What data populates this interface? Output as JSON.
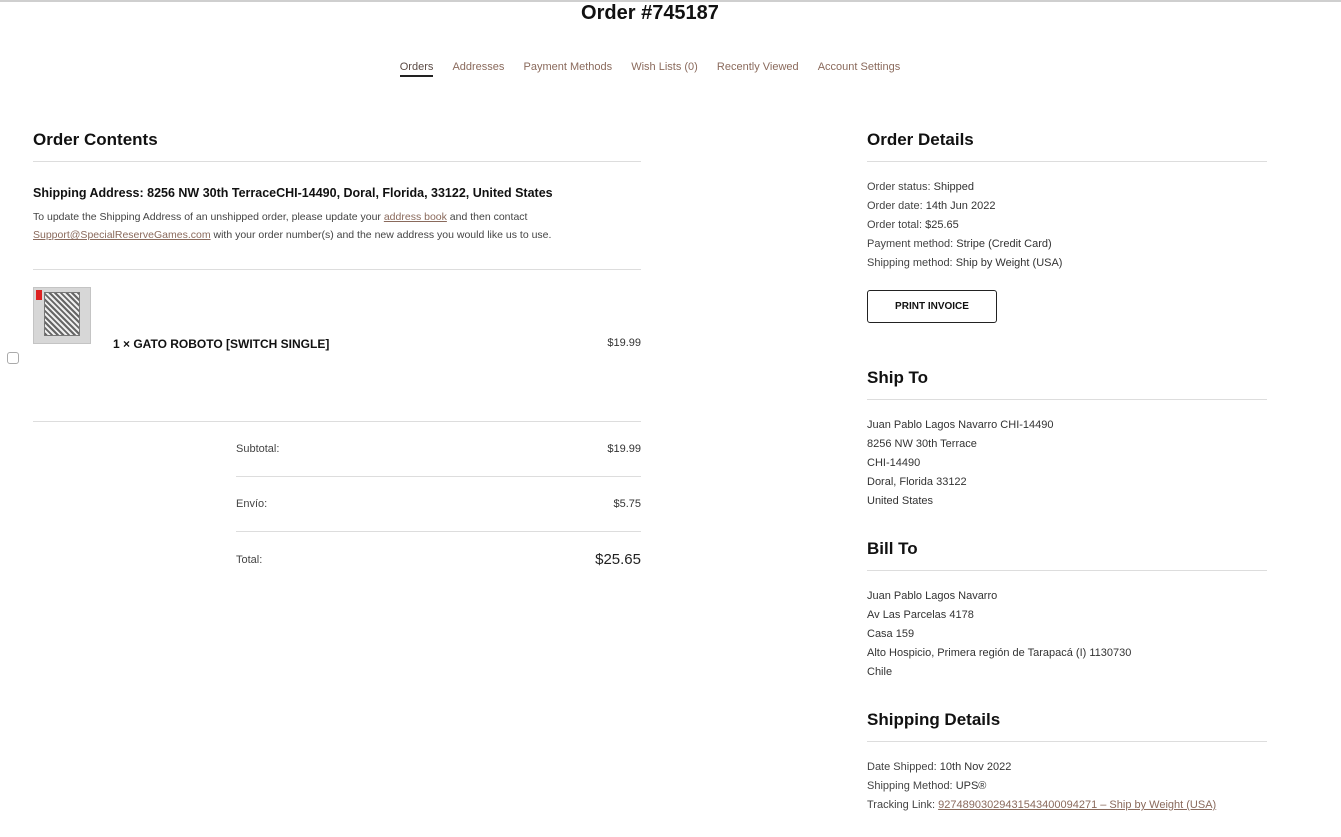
{
  "page": {
    "title": "Order #745187"
  },
  "nav": {
    "items": [
      "Orders",
      "Addresses",
      "Payment Methods",
      "Wish Lists (0)",
      "Recently Viewed",
      "Account Settings"
    ],
    "active": "Orders"
  },
  "order_contents": {
    "heading": "Order Contents",
    "shipping_address": "Shipping Address: 8256 NW 30th TerraceCHI-14490, Doral, Florida, 33122, United States",
    "note_part1": "To update the Shipping Address of an unshipped order, please update your ",
    "note_link1": "address book",
    "note_part2": " and then contact ",
    "note_link2": "Support@SpecialReserveGames.com",
    "note_part3": " with your order number(s) and the new address you would like us to use.",
    "items": [
      {
        "name": "1 × GATO ROBOTO [SWITCH SINGLE]",
        "price": "$19.99"
      }
    ],
    "totals": [
      {
        "label": "Subtotal:",
        "value": "$19.99"
      },
      {
        "label": "Envío:",
        "value": "$5.75"
      },
      {
        "label": "Total:",
        "value": "$25.65"
      }
    ]
  },
  "order_details": {
    "heading": "Order Details",
    "rows": [
      {
        "label": "Order status:",
        "value": "Shipped"
      },
      {
        "label": "Order date:",
        "value": "14th Jun 2022"
      },
      {
        "label": "Order total:",
        "value": "$25.65"
      },
      {
        "label": "Payment method:",
        "value": "Stripe (Credit Card)"
      },
      {
        "label": "Shipping method:",
        "value": "Ship by Weight (USA)"
      }
    ],
    "print_button": "PRINT INVOICE"
  },
  "ship_to": {
    "heading": "Ship To",
    "lines": [
      "Juan Pablo Lagos Navarro CHI-14490",
      "8256 NW 30th Terrace",
      "CHI-14490",
      "Doral, Florida 33122",
      "United States"
    ]
  },
  "bill_to": {
    "heading": "Bill To",
    "lines": [
      "Juan Pablo Lagos Navarro",
      "Av Las Parcelas 4178",
      "Casa 159",
      "Alto Hospicio, Primera región de Tarapacá (I) 1130730",
      "Chile"
    ]
  },
  "shipping_details": {
    "heading": "Shipping Details",
    "date_label": "Date Shipped:",
    "date_value": "10th Nov 2022",
    "method_label": "Shipping Method:",
    "method_value": "UPS®",
    "tracking_label": "Tracking Link:",
    "tracking_value": "92748903029431543400094271 – Ship by Weight (USA)"
  }
}
